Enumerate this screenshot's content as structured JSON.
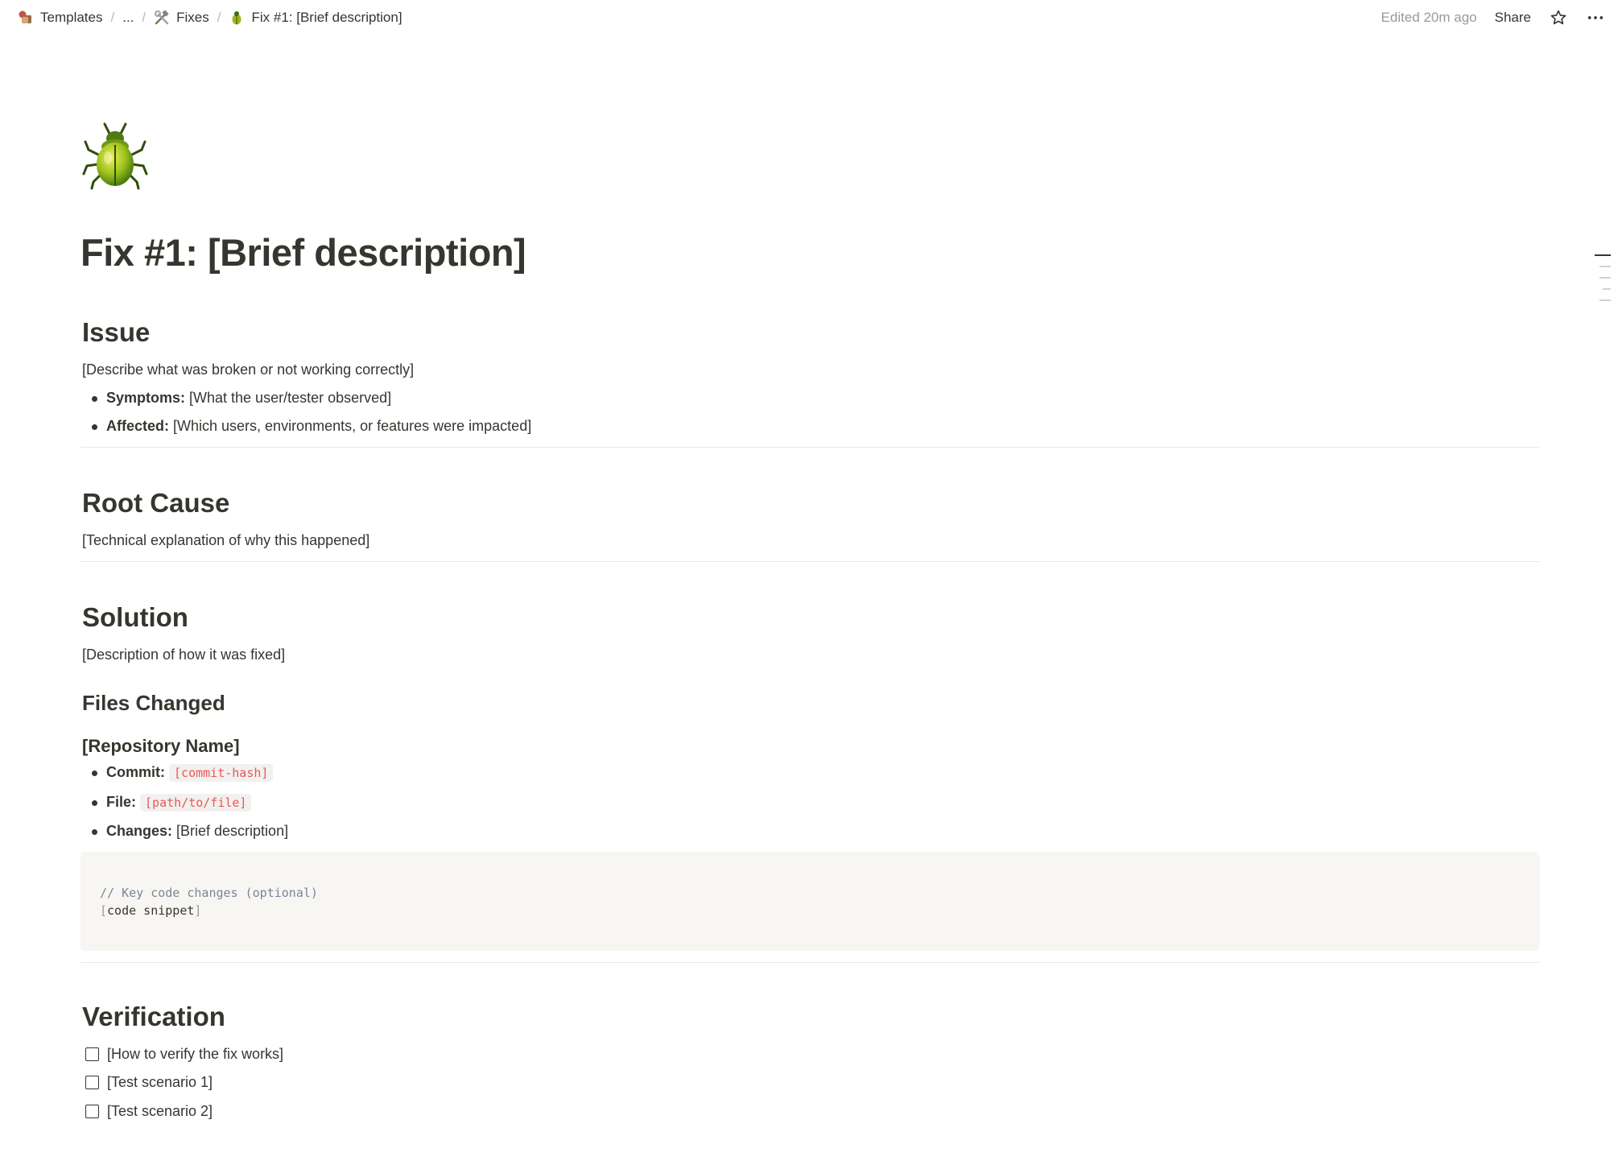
{
  "breadcrumb": {
    "items": [
      {
        "label": "Templates",
        "icon": "templates-stack-icon"
      },
      {
        "label": "...",
        "icon": ""
      },
      {
        "label": "Fixes",
        "icon": "hammer-wrench-icon"
      },
      {
        "label": "Fix #1: [Brief description]",
        "icon": "beetle-icon"
      }
    ],
    "separator": "/"
  },
  "topbar": {
    "edited": "Edited 20m ago",
    "share": "Share",
    "icons": [
      "star-icon",
      "more-horizontal-icon"
    ]
  },
  "page": {
    "icon": "beetle-icon",
    "title": "Fix #1: [Brief description]"
  },
  "issue": {
    "heading": "Issue",
    "description": "[Describe what was broken or not working correctly]",
    "bullets": [
      {
        "label": "Symptoms:",
        "text": " [What the user/tester observed]"
      },
      {
        "label": "Affected:",
        "text": " [Which users, environments, or features were impacted]"
      }
    ]
  },
  "root_cause": {
    "heading": "Root Cause",
    "description": "[Technical explanation of why this happened]"
  },
  "solution": {
    "heading": "Solution",
    "description": "[Description of how it was fixed]",
    "files_changed": {
      "heading": "Files Changed",
      "repo_heading": "[Repository Name]",
      "commit_label": "Commit:",
      "commit_value": "[commit-hash]",
      "file_label": "File:",
      "file_value": "[path/to/file]",
      "changes_label": "Changes:",
      "changes_value": " [Brief description]",
      "code": {
        "comment": "// Key code changes (optional)",
        "open_bracket": "[",
        "text": "code snippet",
        "close_bracket": "]"
      }
    }
  },
  "verification": {
    "heading": "Verification",
    "todos": [
      {
        "text": "[How to verify the fix works]",
        "checked": false
      },
      {
        "text": "[Test scenario 1]",
        "checked": false
      },
      {
        "text": "[Test scenario 2]",
        "checked": false
      }
    ]
  },
  "colors": {
    "text": "#37352f",
    "muted": "#9b9a97",
    "inline_code": "#eb5757",
    "code_bg": "#f7f6f3"
  }
}
